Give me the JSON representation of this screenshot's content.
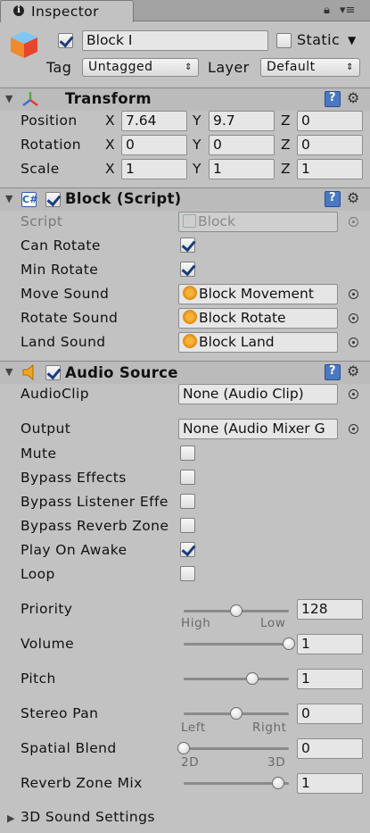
{
  "tab": {
    "title": "Inspector"
  },
  "header": {
    "object_name": "Block I",
    "static_label": "Static",
    "static_checked": false,
    "active_checked": true,
    "tag_label": "Tag",
    "tag_value": "Untagged",
    "layer_label": "Layer",
    "layer_value": "Default"
  },
  "transform": {
    "title": "Transform",
    "rows": [
      {
        "label": "Position",
        "x": "7.64",
        "y": "9.7",
        "z": "0"
      },
      {
        "label": "Rotation",
        "x": "0",
        "y": "0",
        "z": "0"
      },
      {
        "label": "Scale",
        "x": "1",
        "y": "1",
        "z": "1"
      }
    ],
    "axes": {
      "x": "X",
      "y": "Y",
      "z": "Z"
    }
  },
  "block_script": {
    "title": "Block (Script)",
    "script_label": "Script",
    "script_value": "Block",
    "can_rotate_label": "Can Rotate",
    "can_rotate": true,
    "min_rotate_label": "Min Rotate",
    "min_rotate": true,
    "move_sound_label": "Move Sound",
    "move_sound_value": "Block Movement",
    "rotate_sound_label": "Rotate Sound",
    "rotate_sound_value": "Block Rotate",
    "land_sound_label": "Land Sound",
    "land_sound_value": "Block Land"
  },
  "audio_source": {
    "title": "Audio Source",
    "audioclip_label": "AudioClip",
    "audioclip_value": "None (Audio Clip)",
    "output_label": "Output",
    "output_value": "None (Audio Mixer G",
    "mute_label": "Mute",
    "bypass_effects_label": "Bypass Effects",
    "bypass_listener_label": "Bypass Listener Effe",
    "bypass_reverb_label": "Bypass Reverb Zone",
    "play_on_awake_label": "Play On Awake",
    "play_on_awake": true,
    "loop_label": "Loop",
    "priority_label": "Priority",
    "priority_value": "128",
    "priority_min_label": "High",
    "priority_max_label": "Low",
    "priority_level": 0.5,
    "volume_label": "Volume",
    "volume_value": "1",
    "volume_level": 1,
    "pitch_label": "Pitch",
    "pitch_value": "1",
    "pitch_level": 0.65,
    "stereo_pan_label": "Stereo Pan",
    "stereo_pan_value": "0",
    "stereo_pan_level": 0.5,
    "pan_min_label": "Left",
    "pan_max_label": "Right",
    "spatial_blend_label": "Spatial Blend",
    "spatial_blend_value": "0",
    "spatial_blend_level": 0,
    "blend_min_label": "2D",
    "blend_max_label": "3D",
    "reverb_mix_label": "Reverb Zone Mix",
    "reverb_mix_value": "1",
    "reverb_mix_level": 0.9,
    "sound3d_label": "3D Sound Settings"
  },
  "colors": {
    "accent": "#4a78c2",
    "panel": "#c2c2c2",
    "check": "#1a3d7a"
  }
}
